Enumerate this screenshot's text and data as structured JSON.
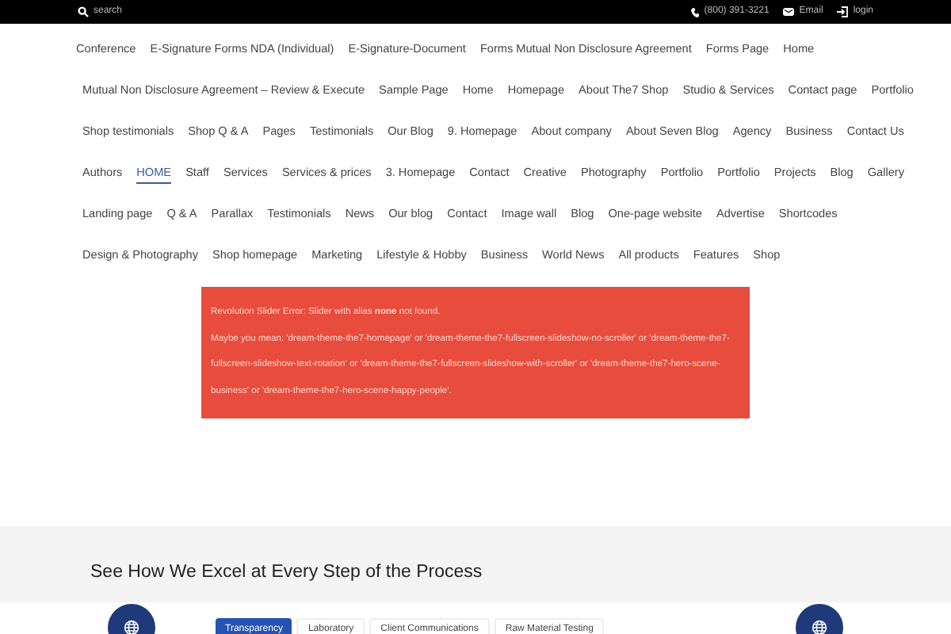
{
  "topbar": {
    "search_placeholder": "search",
    "phone": "(800) 391-3221",
    "email": "Email",
    "login": "login"
  },
  "menu_rows": [
    [
      {
        "label": "Conference",
        "selected": false
      },
      {
        "label": "E-Signature Forms NDA (Individual)",
        "selected": false
      },
      {
        "label": "E-Signature-Document",
        "selected": false
      },
      {
        "label": "Forms Mutual Non Disclosure Agreement",
        "selected": false
      },
      {
        "label": "Forms Page",
        "selected": false
      },
      {
        "label": "Home",
        "selected": false
      }
    ],
    [
      {
        "label": "Mutual Non Disclosure Agreement – Review & Execute",
        "selected": false
      },
      {
        "label": "Sample Page",
        "selected": false
      },
      {
        "label": "Home",
        "selected": false
      },
      {
        "label": "Homepage",
        "selected": false
      },
      {
        "label": "About The7 Shop",
        "selected": false
      },
      {
        "label": "Studio & Services",
        "selected": false
      },
      {
        "label": "Contact page",
        "selected": false
      },
      {
        "label": "Portfolio",
        "selected": false
      }
    ],
    [
      {
        "label": "Shop testimonials",
        "selected": false
      },
      {
        "label": "Shop Q & A",
        "selected": false
      },
      {
        "label": "Pages",
        "selected": false
      },
      {
        "label": "Testimonials",
        "selected": false
      },
      {
        "label": "Our Blog",
        "selected": false
      },
      {
        "label": "9. Homepage",
        "selected": false
      },
      {
        "label": "About company",
        "selected": false
      },
      {
        "label": "About Seven Blog",
        "selected": false
      },
      {
        "label": "Agency",
        "selected": false
      },
      {
        "label": "Business",
        "selected": false
      },
      {
        "label": "Contact Us",
        "selected": false
      }
    ],
    [
      {
        "label": "Authors",
        "selected": false
      },
      {
        "label": "HOME",
        "selected": true
      },
      {
        "label": "Staff",
        "selected": false
      },
      {
        "label": "Services",
        "selected": false
      },
      {
        "label": "Services & prices",
        "selected": false
      },
      {
        "label": "3. Homepage",
        "selected": false
      },
      {
        "label": "Contact",
        "selected": false
      },
      {
        "label": "Creative",
        "selected": false
      },
      {
        "label": "Photography",
        "selected": false
      },
      {
        "label": "Portfolio",
        "selected": false
      },
      {
        "label": "Portfolio",
        "selected": false
      },
      {
        "label": "Projects",
        "selected": false
      },
      {
        "label": "Blog",
        "selected": false
      },
      {
        "label": "Gallery",
        "selected": false
      }
    ],
    [
      {
        "label": "Landing page",
        "selected": false
      },
      {
        "label": "Q & A",
        "selected": false
      },
      {
        "label": "Parallax",
        "selected": false
      },
      {
        "label": "Testimonials",
        "selected": false
      },
      {
        "label": "News",
        "selected": false
      },
      {
        "label": "Our blog",
        "selected": false
      },
      {
        "label": "Contact",
        "selected": false
      },
      {
        "label": "Image wall",
        "selected": false
      },
      {
        "label": "Blog",
        "selected": false
      },
      {
        "label": "One-page website",
        "selected": false
      },
      {
        "label": "Advertise",
        "selected": false
      },
      {
        "label": "Shortcodes",
        "selected": false
      }
    ],
    [
      {
        "label": "Design & Photography",
        "selected": false
      },
      {
        "label": "Shop homepage",
        "selected": false
      },
      {
        "label": "Marketing",
        "selected": false
      },
      {
        "label": "Lifestyle & Hobby",
        "selected": false
      },
      {
        "label": "Business",
        "selected": false
      },
      {
        "label": "World News",
        "selected": false
      },
      {
        "label": "All products",
        "selected": false
      },
      {
        "label": "Features",
        "selected": false
      },
      {
        "label": "Shop",
        "selected": false
      }
    ]
  ],
  "error": {
    "line1": "Revolution Slider Error: Slider with alias **none** not found.",
    "line2": "Maybe you mean: 'dream-theme-the7-homepage' or 'dream-theme-the7-fullscreen-slideshow-no-scroller' or 'dream-theme-the7-fullscreen-slideshow-text-rotation' or 'dream-theme-the7-fullscreen-slideshow-with-scroller' or 'dream-theme-the7-hero-scene-business' or 'dream-theme-the7-hero-scene-happy-people'."
  },
  "section": {
    "heading": "See How We Excel at Every Step of the Process"
  },
  "tabs": [
    {
      "label": "Transparency",
      "selected": true
    },
    {
      "label": "Laboratory",
      "selected": false
    },
    {
      "label": "Client Communications",
      "selected": false
    },
    {
      "label": "Raw Material Testing",
      "selected": false
    }
  ]
}
